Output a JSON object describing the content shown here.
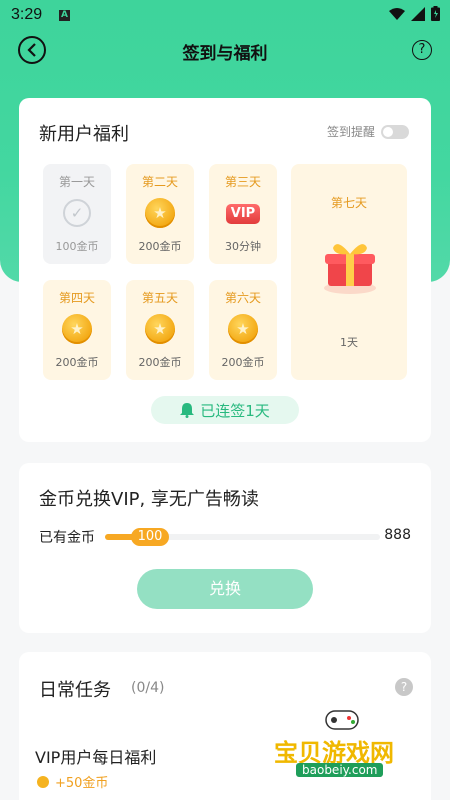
{
  "status": {
    "time": "3:29",
    "notif": "A"
  },
  "nav": {
    "title": "签到与福利",
    "help": "?"
  },
  "signin": {
    "title": "新用户福利",
    "remind_label": "签到提醒",
    "days": [
      {
        "label": "第一天",
        "reward": "100金币",
        "icon": "check-icon",
        "state": "done"
      },
      {
        "label": "第二天",
        "reward": "200金币",
        "icon": "coin-icon"
      },
      {
        "label": "第三天",
        "reward": "30分钟",
        "icon": "vip-icon"
      },
      {
        "label": "第四天",
        "reward": "200金币",
        "icon": "coin-icon"
      },
      {
        "label": "第五天",
        "reward": "200金币",
        "icon": "coin-icon"
      },
      {
        "label": "第六天",
        "reward": "200金币",
        "icon": "coin-icon"
      }
    ],
    "day7": {
      "label": "第七天",
      "reward": "1天",
      "icon": "gift-icon"
    },
    "streak": "已连签1天",
    "vip_text": "VIP"
  },
  "exchange": {
    "title": "金币兑换VIP, 享无广告畅读",
    "have_label": "已有金币",
    "current": "100",
    "max": "888",
    "progress": 0.113,
    "button": "兑换"
  },
  "tasks": {
    "title": "日常任务",
    "count": "(0/4)",
    "items": [
      {
        "name": "VIP用户每日福利",
        "reward": "+50金币"
      }
    ]
  },
  "watermark": {
    "text": "宝贝游戏网",
    "url": "baobeiy.com"
  },
  "colors": {
    "accent": "#3ed49b",
    "coin": "#f7a823"
  }
}
